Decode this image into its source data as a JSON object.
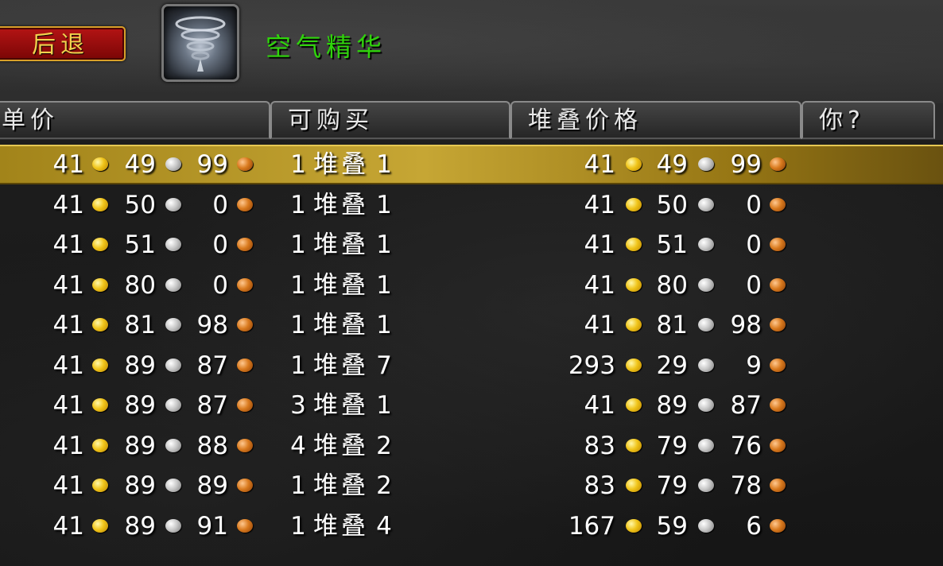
{
  "header": {
    "back_label": "后退",
    "item_name": "空气精华",
    "item_icon": "air-essence-icon"
  },
  "columns": {
    "unit_price": "单价",
    "available": "可购买",
    "stack_price": "堆叠价格",
    "you": "你?"
  },
  "stack_word": "堆叠",
  "colors": {
    "selected_row": "#c6a634",
    "item_name": "#2fd40b",
    "back_button": "#b41414"
  },
  "rows": [
    {
      "unit": [
        "41",
        "49",
        "99"
      ],
      "count": "1",
      "size": "1",
      "total": [
        "41",
        "49",
        "99"
      ],
      "selected": true
    },
    {
      "unit": [
        "41",
        "50",
        "0"
      ],
      "count": "1",
      "size": "1",
      "total": [
        "41",
        "50",
        "0"
      ]
    },
    {
      "unit": [
        "41",
        "51",
        "0"
      ],
      "count": "1",
      "size": "1",
      "total": [
        "41",
        "51",
        "0"
      ]
    },
    {
      "unit": [
        "41",
        "80",
        "0"
      ],
      "count": "1",
      "size": "1",
      "total": [
        "41",
        "80",
        "0"
      ]
    },
    {
      "unit": [
        "41",
        "81",
        "98"
      ],
      "count": "1",
      "size": "1",
      "total": [
        "41",
        "81",
        "98"
      ]
    },
    {
      "unit": [
        "41",
        "89",
        "87"
      ],
      "count": "1",
      "size": "7",
      "total": [
        "293",
        "29",
        "9"
      ]
    },
    {
      "unit": [
        "41",
        "89",
        "87"
      ],
      "count": "3",
      "size": "1",
      "total": [
        "41",
        "89",
        "87"
      ]
    },
    {
      "unit": [
        "41",
        "89",
        "88"
      ],
      "count": "4",
      "size": "2",
      "total": [
        "83",
        "79",
        "76"
      ]
    },
    {
      "unit": [
        "41",
        "89",
        "89"
      ],
      "count": "1",
      "size": "2",
      "total": [
        "83",
        "79",
        "78"
      ]
    },
    {
      "unit": [
        "41",
        "89",
        "91"
      ],
      "count": "1",
      "size": "4",
      "total": [
        "167",
        "59",
        "6"
      ]
    }
  ]
}
